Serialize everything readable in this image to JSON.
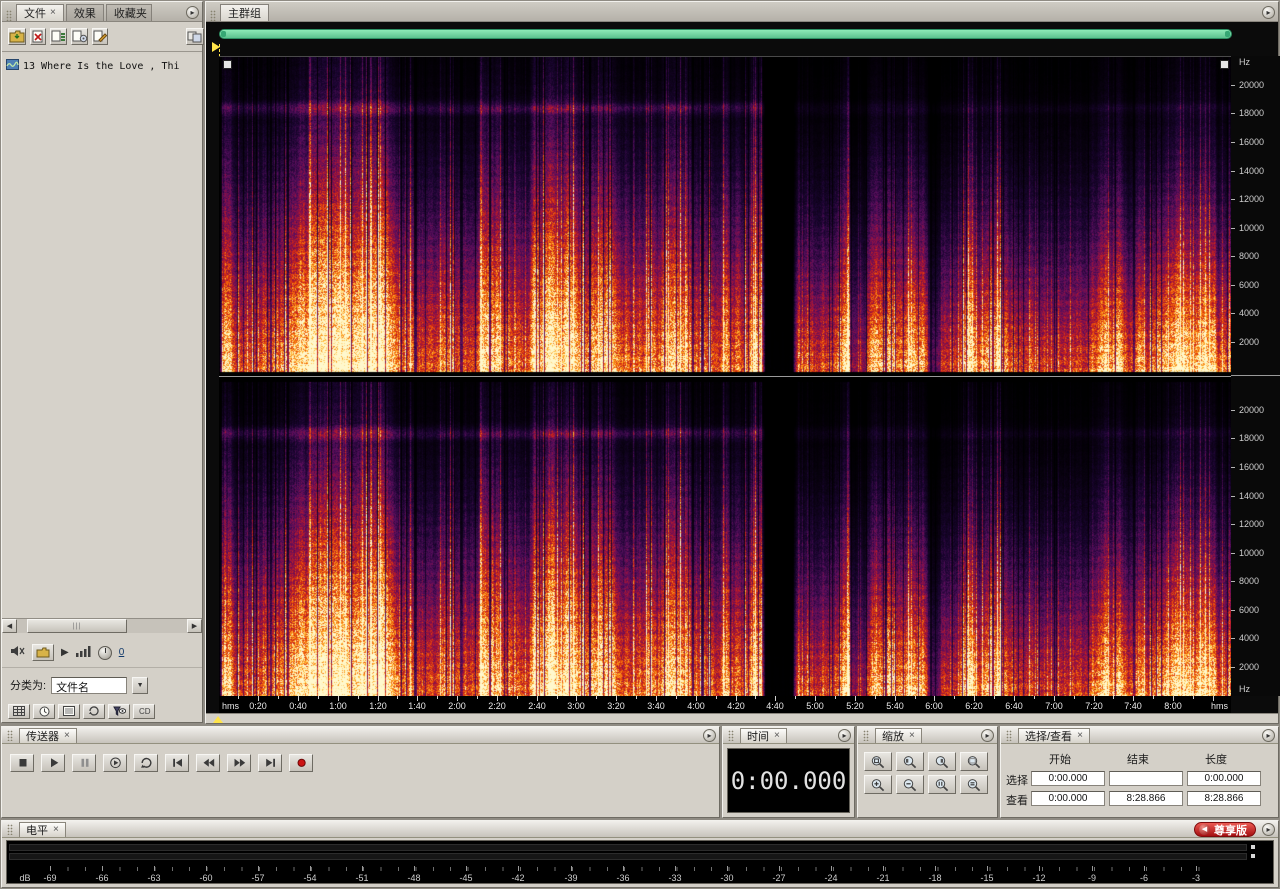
{
  "left_panel": {
    "tabs": [
      {
        "label": "文件",
        "close": "×"
      },
      {
        "label": "效果",
        "close": ""
      },
      {
        "label": "收藏夹",
        "close": ""
      }
    ],
    "toolbar_icons": [
      "import-file",
      "close-file",
      "insert-into-multitrack",
      "insert-into-cd",
      "edit-original",
      "options-view"
    ],
    "files": [
      {
        "icon": "audio-file",
        "name": "13 Where Is the Love , Thi"
      }
    ],
    "preview": {
      "volume_link": "0"
    },
    "sort": {
      "label": "分类为:",
      "value": "文件名"
    },
    "view_toggles": [
      "grid",
      "clock",
      "list",
      "loop",
      "filter-eye",
      "cd-text"
    ]
  },
  "main": {
    "tab_label": "主群组",
    "freq_unit": "Hz",
    "freq_ticks": [
      20000,
      18000,
      16000,
      14000,
      12000,
      10000,
      8000,
      6000,
      4000,
      2000
    ],
    "time_unit": "hms",
    "time_ticks": [
      "0:20",
      "0:40",
      "1:00",
      "1:20",
      "1:40",
      "2:00",
      "2:20",
      "2:40",
      "3:00",
      "3:20",
      "3:40",
      "4:00",
      "4:20",
      "4:40",
      "5:00",
      "5:20",
      "5:40",
      "6:00",
      "6:20",
      "6:40",
      "7:00",
      "7:20",
      "7:40",
      "8:00"
    ]
  },
  "spectrogram": {
    "channels": 2,
    "duration": "8:28.866",
    "duration_seconds": 508.866,
    "silence_gap_time": "4:38-4:52",
    "palette": [
      "#000000",
      "#1a052e",
      "#560e5e",
      "#981242",
      "#d22814",
      "#f46808",
      "#ffb62c",
      "#fff8cd"
    ]
  },
  "panels": {
    "transport": {
      "title": "传送器",
      "close": "×",
      "buttons": [
        "stop",
        "play",
        "pause",
        "play-looped",
        "loop",
        "go-to-start",
        "rewind",
        "fast-forward",
        "go-to-end",
        "record"
      ]
    },
    "time": {
      "title": "时间",
      "close": "×",
      "value": "0:00.000"
    },
    "zoom": {
      "title": "缩放",
      "close": "×",
      "buttons": [
        "zoom-to-selection",
        "zoom-selection-left",
        "zoom-selection-right",
        "zoom-out-full",
        "zoom-in-horizontal",
        "zoom-out-horizontal",
        "zoom-in-vertical",
        "zoom-out-vertical"
      ]
    },
    "selection": {
      "title": "选择/查看",
      "close": "×",
      "columns": [
        "开始",
        "结束",
        "长度"
      ],
      "rows": [
        {
          "label": "选择",
          "start": "0:00.000",
          "end": "",
          "length": "0:00.000"
        },
        {
          "label": "查看",
          "start": "0:00.000",
          "end": "8:28.866",
          "length": "8:28.866"
        }
      ]
    },
    "level": {
      "title": "电平",
      "close": "×",
      "unit": "dB",
      "db_ticks": [
        -69,
        -66,
        -63,
        -60,
        -57,
        -54,
        -51,
        -48,
        -45,
        -42,
        -39,
        -36,
        -33,
        -30,
        -27,
        -24,
        -21,
        -18,
        -15,
        -12,
        -9,
        -6,
        -3
      ]
    }
  },
  "badge": {
    "label": "尊享版"
  }
}
